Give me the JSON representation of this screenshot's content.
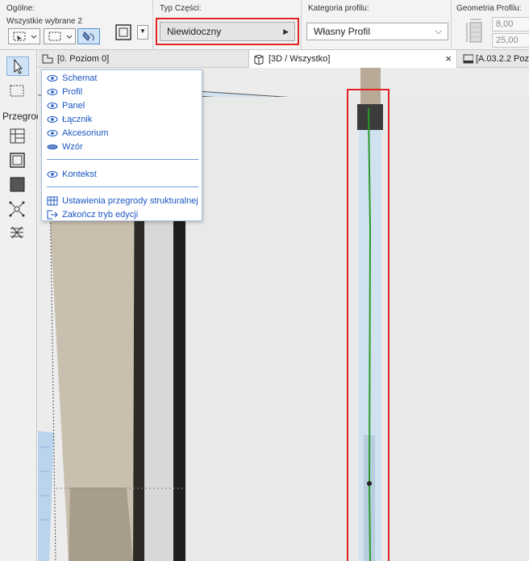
{
  "infobar": {
    "general": {
      "label": "Ogólne:",
      "selection": "Wszystkie wybrane 2"
    },
    "part_type": {
      "label": "Typ Części:",
      "value": "Niewidoczny"
    },
    "profile_category": {
      "label": "Kategoria profilu:",
      "value": "Własny Profil"
    },
    "profile_geometry": {
      "label": "Geometria Profilu:",
      "width": "8,00",
      "depth": "25,00"
    }
  },
  "toolbox": {
    "group_label": "Przegroc"
  },
  "tabs": [
    {
      "label": "[0. Poziom 0]"
    },
    {
      "label": "[3D / Wszystko]",
      "close": "×"
    },
    {
      "label": "[A.03.2.2 Poz"
    }
  ],
  "menu": {
    "items": [
      {
        "label": "Schemat",
        "icon": "eye-icon"
      },
      {
        "label": "Profil",
        "icon": "eye-icon"
      },
      {
        "label": "Panel",
        "icon": "eye-icon"
      },
      {
        "label": "Łącznik",
        "icon": "eye-icon"
      },
      {
        "label": "Akcesorium",
        "icon": "eye-icon"
      },
      {
        "label": "Wzór",
        "icon": "eye-closed-icon"
      }
    ],
    "context": {
      "label": "Kontekst",
      "icon": "eye-icon"
    },
    "actions": [
      {
        "label": "Ustawienia przegrody strukturalnej",
        "icon": "grid-settings-icon"
      },
      {
        "label": "Zakończ tryb edycji",
        "icon": "exit-icon"
      }
    ]
  },
  "colors": {
    "accent": "#1a56c2",
    "highlight": "#e32222",
    "centerline": "#2a9a2a"
  }
}
